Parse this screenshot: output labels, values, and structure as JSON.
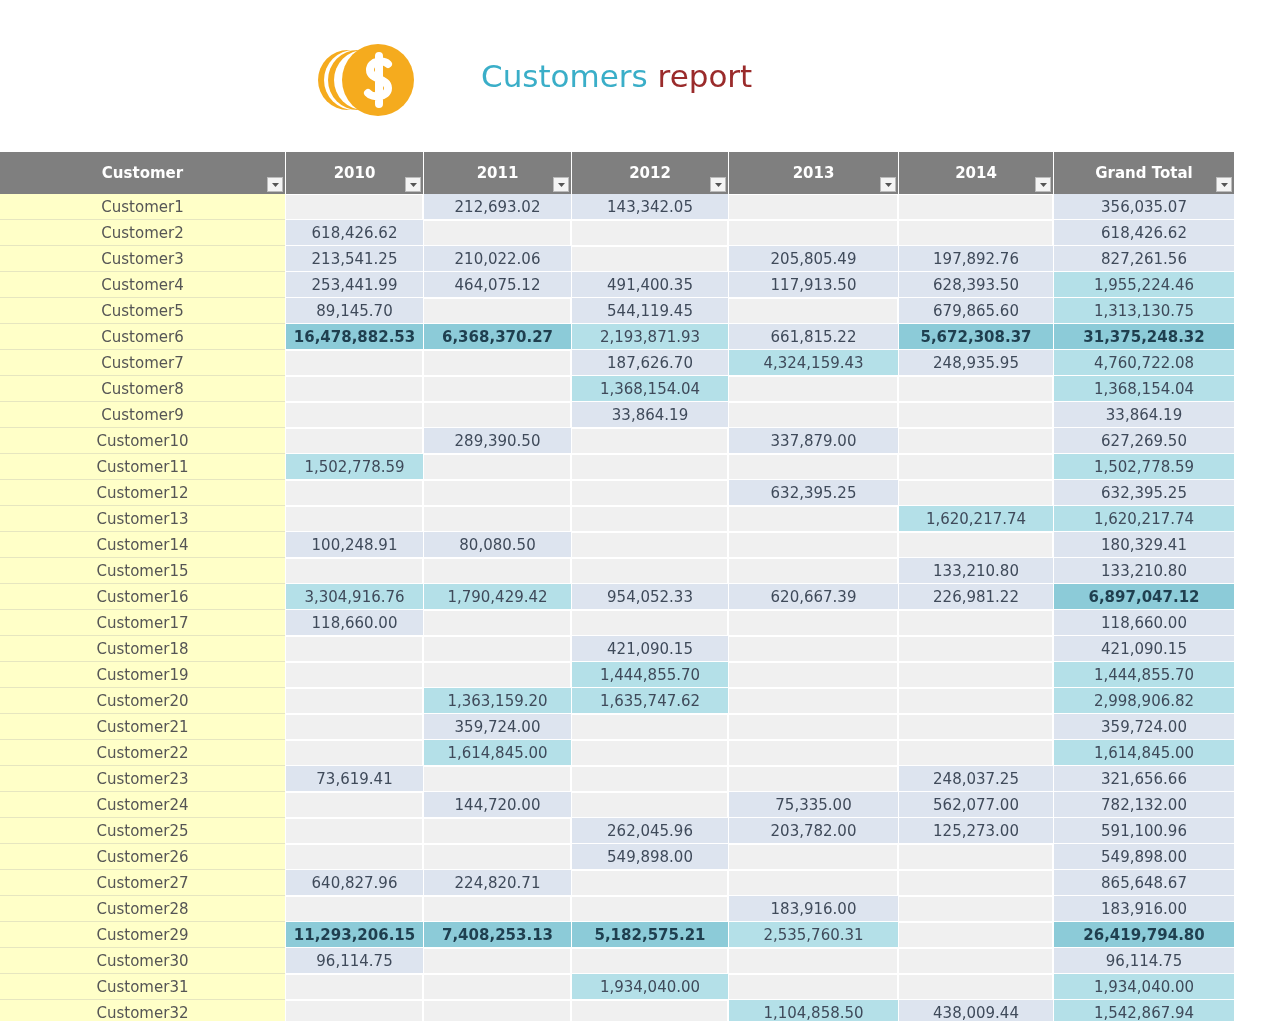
{
  "title": {
    "lead": "Customers",
    "accent": "report"
  },
  "table": {
    "columns": [
      "Customer",
      "2010",
      "2011",
      "2012",
      "2013",
      "2014",
      "Grand Total"
    ],
    "rows": [
      [
        {
          "value": "Customer1",
          "kind": "name"
        },
        {
          "kind": "empty"
        },
        {
          "value": "212,693.02",
          "kind": "low"
        },
        {
          "value": "143,342.05",
          "kind": "low"
        },
        {
          "kind": "empty"
        },
        {
          "kind": "empty"
        },
        {
          "value": "356,035.07",
          "kind": "low"
        }
      ],
      [
        {
          "value": "Customer2",
          "kind": "name"
        },
        {
          "value": "618,426.62",
          "kind": "low"
        },
        {
          "kind": "empty"
        },
        {
          "kind": "empty"
        },
        {
          "kind": "empty"
        },
        {
          "kind": "empty"
        },
        {
          "value": "618,426.62",
          "kind": "low"
        }
      ],
      [
        {
          "value": "Customer3",
          "kind": "name"
        },
        {
          "value": "213,541.25",
          "kind": "low"
        },
        {
          "value": "210,022.06",
          "kind": "low"
        },
        {
          "kind": "empty"
        },
        {
          "value": "205,805.49",
          "kind": "low"
        },
        {
          "value": "197,892.76",
          "kind": "low"
        },
        {
          "value": "827,261.56",
          "kind": "low"
        }
      ],
      [
        {
          "value": "Customer4",
          "kind": "name"
        },
        {
          "value": "253,441.99",
          "kind": "low"
        },
        {
          "value": "464,075.12",
          "kind": "low"
        },
        {
          "value": "491,400.35",
          "kind": "low"
        },
        {
          "value": "117,913.50",
          "kind": "low"
        },
        {
          "value": "628,393.50",
          "kind": "low"
        },
        {
          "value": "1,955,224.46",
          "kind": "mid"
        }
      ],
      [
        {
          "value": "Customer5",
          "kind": "name"
        },
        {
          "value": "89,145.70",
          "kind": "low"
        },
        {
          "kind": "empty"
        },
        {
          "value": "544,119.45",
          "kind": "low"
        },
        {
          "kind": "empty"
        },
        {
          "value": "679,865.60",
          "kind": "low"
        },
        {
          "value": "1,313,130.75",
          "kind": "mid"
        }
      ],
      [
        {
          "value": "Customer6",
          "kind": "name"
        },
        {
          "value": "16,478,882.53",
          "kind": "high"
        },
        {
          "value": "6,368,370.27",
          "kind": "high"
        },
        {
          "value": "2,193,871.93",
          "kind": "mid"
        },
        {
          "value": "661,815.22",
          "kind": "low"
        },
        {
          "value": "5,672,308.37",
          "kind": "high"
        },
        {
          "value": "31,375,248.32",
          "kind": "high"
        }
      ],
      [
        {
          "value": "Customer7",
          "kind": "name"
        },
        {
          "kind": "empty"
        },
        {
          "kind": "empty"
        },
        {
          "value": "187,626.70",
          "kind": "low"
        },
        {
          "value": "4,324,159.43",
          "kind": "mid"
        },
        {
          "value": "248,935.95",
          "kind": "low"
        },
        {
          "value": "4,760,722.08",
          "kind": "mid"
        }
      ],
      [
        {
          "value": "Customer8",
          "kind": "name"
        },
        {
          "kind": "empty"
        },
        {
          "kind": "empty"
        },
        {
          "value": "1,368,154.04",
          "kind": "mid"
        },
        {
          "kind": "empty"
        },
        {
          "kind": "empty"
        },
        {
          "value": "1,368,154.04",
          "kind": "mid"
        }
      ],
      [
        {
          "value": "Customer9",
          "kind": "name"
        },
        {
          "kind": "empty"
        },
        {
          "kind": "empty"
        },
        {
          "value": "33,864.19",
          "kind": "low"
        },
        {
          "kind": "empty"
        },
        {
          "kind": "empty"
        },
        {
          "value": "33,864.19",
          "kind": "low"
        }
      ],
      [
        {
          "value": "Customer10",
          "kind": "name"
        },
        {
          "kind": "empty"
        },
        {
          "value": "289,390.50",
          "kind": "low"
        },
        {
          "kind": "empty"
        },
        {
          "value": "337,879.00",
          "kind": "low"
        },
        {
          "kind": "empty"
        },
        {
          "value": "627,269.50",
          "kind": "low"
        }
      ],
      [
        {
          "value": "Customer11",
          "kind": "name"
        },
        {
          "value": "1,502,778.59",
          "kind": "mid"
        },
        {
          "kind": "empty"
        },
        {
          "kind": "empty"
        },
        {
          "kind": "empty"
        },
        {
          "kind": "empty"
        },
        {
          "value": "1,502,778.59",
          "kind": "mid"
        }
      ],
      [
        {
          "value": "Customer12",
          "kind": "name"
        },
        {
          "kind": "empty"
        },
        {
          "kind": "empty"
        },
        {
          "kind": "empty"
        },
        {
          "value": "632,395.25",
          "kind": "low"
        },
        {
          "kind": "empty"
        },
        {
          "value": "632,395.25",
          "kind": "low"
        }
      ],
      [
        {
          "value": "Customer13",
          "kind": "name"
        },
        {
          "kind": "empty"
        },
        {
          "kind": "empty"
        },
        {
          "kind": "empty"
        },
        {
          "kind": "empty"
        },
        {
          "value": "1,620,217.74",
          "kind": "mid"
        },
        {
          "value": "1,620,217.74",
          "kind": "mid"
        }
      ],
      [
        {
          "value": "Customer14",
          "kind": "name"
        },
        {
          "value": "100,248.91",
          "kind": "low"
        },
        {
          "value": "80,080.50",
          "kind": "low"
        },
        {
          "kind": "empty"
        },
        {
          "kind": "empty"
        },
        {
          "kind": "empty"
        },
        {
          "value": "180,329.41",
          "kind": "low"
        }
      ],
      [
        {
          "value": "Customer15",
          "kind": "name"
        },
        {
          "kind": "empty"
        },
        {
          "kind": "empty"
        },
        {
          "kind": "empty"
        },
        {
          "kind": "empty"
        },
        {
          "value": "133,210.80",
          "kind": "low"
        },
        {
          "value": "133,210.80",
          "kind": "low"
        }
      ],
      [
        {
          "value": "Customer16",
          "kind": "name"
        },
        {
          "value": "3,304,916.76",
          "kind": "mid"
        },
        {
          "value": "1,790,429.42",
          "kind": "mid"
        },
        {
          "value": "954,052.33",
          "kind": "low"
        },
        {
          "value": "620,667.39",
          "kind": "low"
        },
        {
          "value": "226,981.22",
          "kind": "low"
        },
        {
          "value": "6,897,047.12",
          "kind": "high"
        }
      ],
      [
        {
          "value": "Customer17",
          "kind": "name"
        },
        {
          "value": "118,660.00",
          "kind": "low"
        },
        {
          "kind": "empty"
        },
        {
          "kind": "empty"
        },
        {
          "kind": "empty"
        },
        {
          "kind": "empty"
        },
        {
          "value": "118,660.00",
          "kind": "low"
        }
      ],
      [
        {
          "value": "Customer18",
          "kind": "name"
        },
        {
          "kind": "empty"
        },
        {
          "kind": "empty"
        },
        {
          "value": "421,090.15",
          "kind": "low"
        },
        {
          "kind": "empty"
        },
        {
          "kind": "empty"
        },
        {
          "value": "421,090.15",
          "kind": "low"
        }
      ],
      [
        {
          "value": "Customer19",
          "kind": "name"
        },
        {
          "kind": "empty"
        },
        {
          "kind": "empty"
        },
        {
          "value": "1,444,855.70",
          "kind": "mid"
        },
        {
          "kind": "empty"
        },
        {
          "kind": "empty"
        },
        {
          "value": "1,444,855.70",
          "kind": "mid"
        }
      ],
      [
        {
          "value": "Customer20",
          "kind": "name"
        },
        {
          "kind": "empty"
        },
        {
          "value": "1,363,159.20",
          "kind": "mid"
        },
        {
          "value": "1,635,747.62",
          "kind": "mid"
        },
        {
          "kind": "empty"
        },
        {
          "kind": "empty"
        },
        {
          "value": "2,998,906.82",
          "kind": "mid"
        }
      ],
      [
        {
          "value": "Customer21",
          "kind": "name"
        },
        {
          "kind": "empty"
        },
        {
          "value": "359,724.00",
          "kind": "low"
        },
        {
          "kind": "empty"
        },
        {
          "kind": "empty"
        },
        {
          "kind": "empty"
        },
        {
          "value": "359,724.00",
          "kind": "low"
        }
      ],
      [
        {
          "value": "Customer22",
          "kind": "name"
        },
        {
          "kind": "empty"
        },
        {
          "value": "1,614,845.00",
          "kind": "mid"
        },
        {
          "kind": "empty"
        },
        {
          "kind": "empty"
        },
        {
          "kind": "empty"
        },
        {
          "value": "1,614,845.00",
          "kind": "mid"
        }
      ],
      [
        {
          "value": "Customer23",
          "kind": "name"
        },
        {
          "value": "73,619.41",
          "kind": "low"
        },
        {
          "kind": "empty"
        },
        {
          "kind": "empty"
        },
        {
          "kind": "empty"
        },
        {
          "value": "248,037.25",
          "kind": "low"
        },
        {
          "value": "321,656.66",
          "kind": "low"
        }
      ],
      [
        {
          "value": "Customer24",
          "kind": "name"
        },
        {
          "kind": "empty"
        },
        {
          "value": "144,720.00",
          "kind": "low"
        },
        {
          "kind": "empty"
        },
        {
          "value": "75,335.00",
          "kind": "low"
        },
        {
          "value": "562,077.00",
          "kind": "low"
        },
        {
          "value": "782,132.00",
          "kind": "low"
        }
      ],
      [
        {
          "value": "Customer25",
          "kind": "name"
        },
        {
          "kind": "empty"
        },
        {
          "kind": "empty"
        },
        {
          "value": "262,045.96",
          "kind": "low"
        },
        {
          "value": "203,782.00",
          "kind": "low"
        },
        {
          "value": "125,273.00",
          "kind": "low"
        },
        {
          "value": "591,100.96",
          "kind": "low"
        }
      ],
      [
        {
          "value": "Customer26",
          "kind": "name"
        },
        {
          "kind": "empty"
        },
        {
          "kind": "empty"
        },
        {
          "value": "549,898.00",
          "kind": "low"
        },
        {
          "kind": "empty"
        },
        {
          "kind": "empty"
        },
        {
          "value": "549,898.00",
          "kind": "low"
        }
      ],
      [
        {
          "value": "Customer27",
          "kind": "name"
        },
        {
          "value": "640,827.96",
          "kind": "low"
        },
        {
          "value": "224,820.71",
          "kind": "low"
        },
        {
          "kind": "empty"
        },
        {
          "kind": "empty"
        },
        {
          "kind": "empty"
        },
        {
          "value": "865,648.67",
          "kind": "low"
        }
      ],
      [
        {
          "value": "Customer28",
          "kind": "name"
        },
        {
          "kind": "empty"
        },
        {
          "kind": "empty"
        },
        {
          "kind": "empty"
        },
        {
          "value": "183,916.00",
          "kind": "low"
        },
        {
          "kind": "empty"
        },
        {
          "value": "183,916.00",
          "kind": "low"
        }
      ],
      [
        {
          "value": "Customer29",
          "kind": "name"
        },
        {
          "value": "11,293,206.15",
          "kind": "high"
        },
        {
          "value": "7,408,253.13",
          "kind": "high"
        },
        {
          "value": "5,182,575.21",
          "kind": "high"
        },
        {
          "value": "2,535,760.31",
          "kind": "mid"
        },
        {
          "kind": "empty"
        },
        {
          "value": "26,419,794.80",
          "kind": "high"
        }
      ],
      [
        {
          "value": "Customer30",
          "kind": "name"
        },
        {
          "value": "96,114.75",
          "kind": "low"
        },
        {
          "kind": "empty"
        },
        {
          "kind": "empty"
        },
        {
          "kind": "empty"
        },
        {
          "kind": "empty"
        },
        {
          "value": "96,114.75",
          "kind": "low"
        }
      ],
      [
        {
          "value": "Customer31",
          "kind": "name"
        },
        {
          "kind": "empty"
        },
        {
          "kind": "empty"
        },
        {
          "value": "1,934,040.00",
          "kind": "mid"
        },
        {
          "kind": "empty"
        },
        {
          "kind": "empty"
        },
        {
          "value": "1,934,040.00",
          "kind": "mid"
        }
      ],
      [
        {
          "value": "Customer32",
          "kind": "name"
        },
        {
          "kind": "empty"
        },
        {
          "kind": "empty"
        },
        {
          "kind": "empty"
        },
        {
          "value": "1,104,858.50",
          "kind": "mid"
        },
        {
          "value": "438,009.44",
          "kind": "low"
        },
        {
          "value": "1,542,867.94",
          "kind": "mid"
        }
      ]
    ]
  }
}
